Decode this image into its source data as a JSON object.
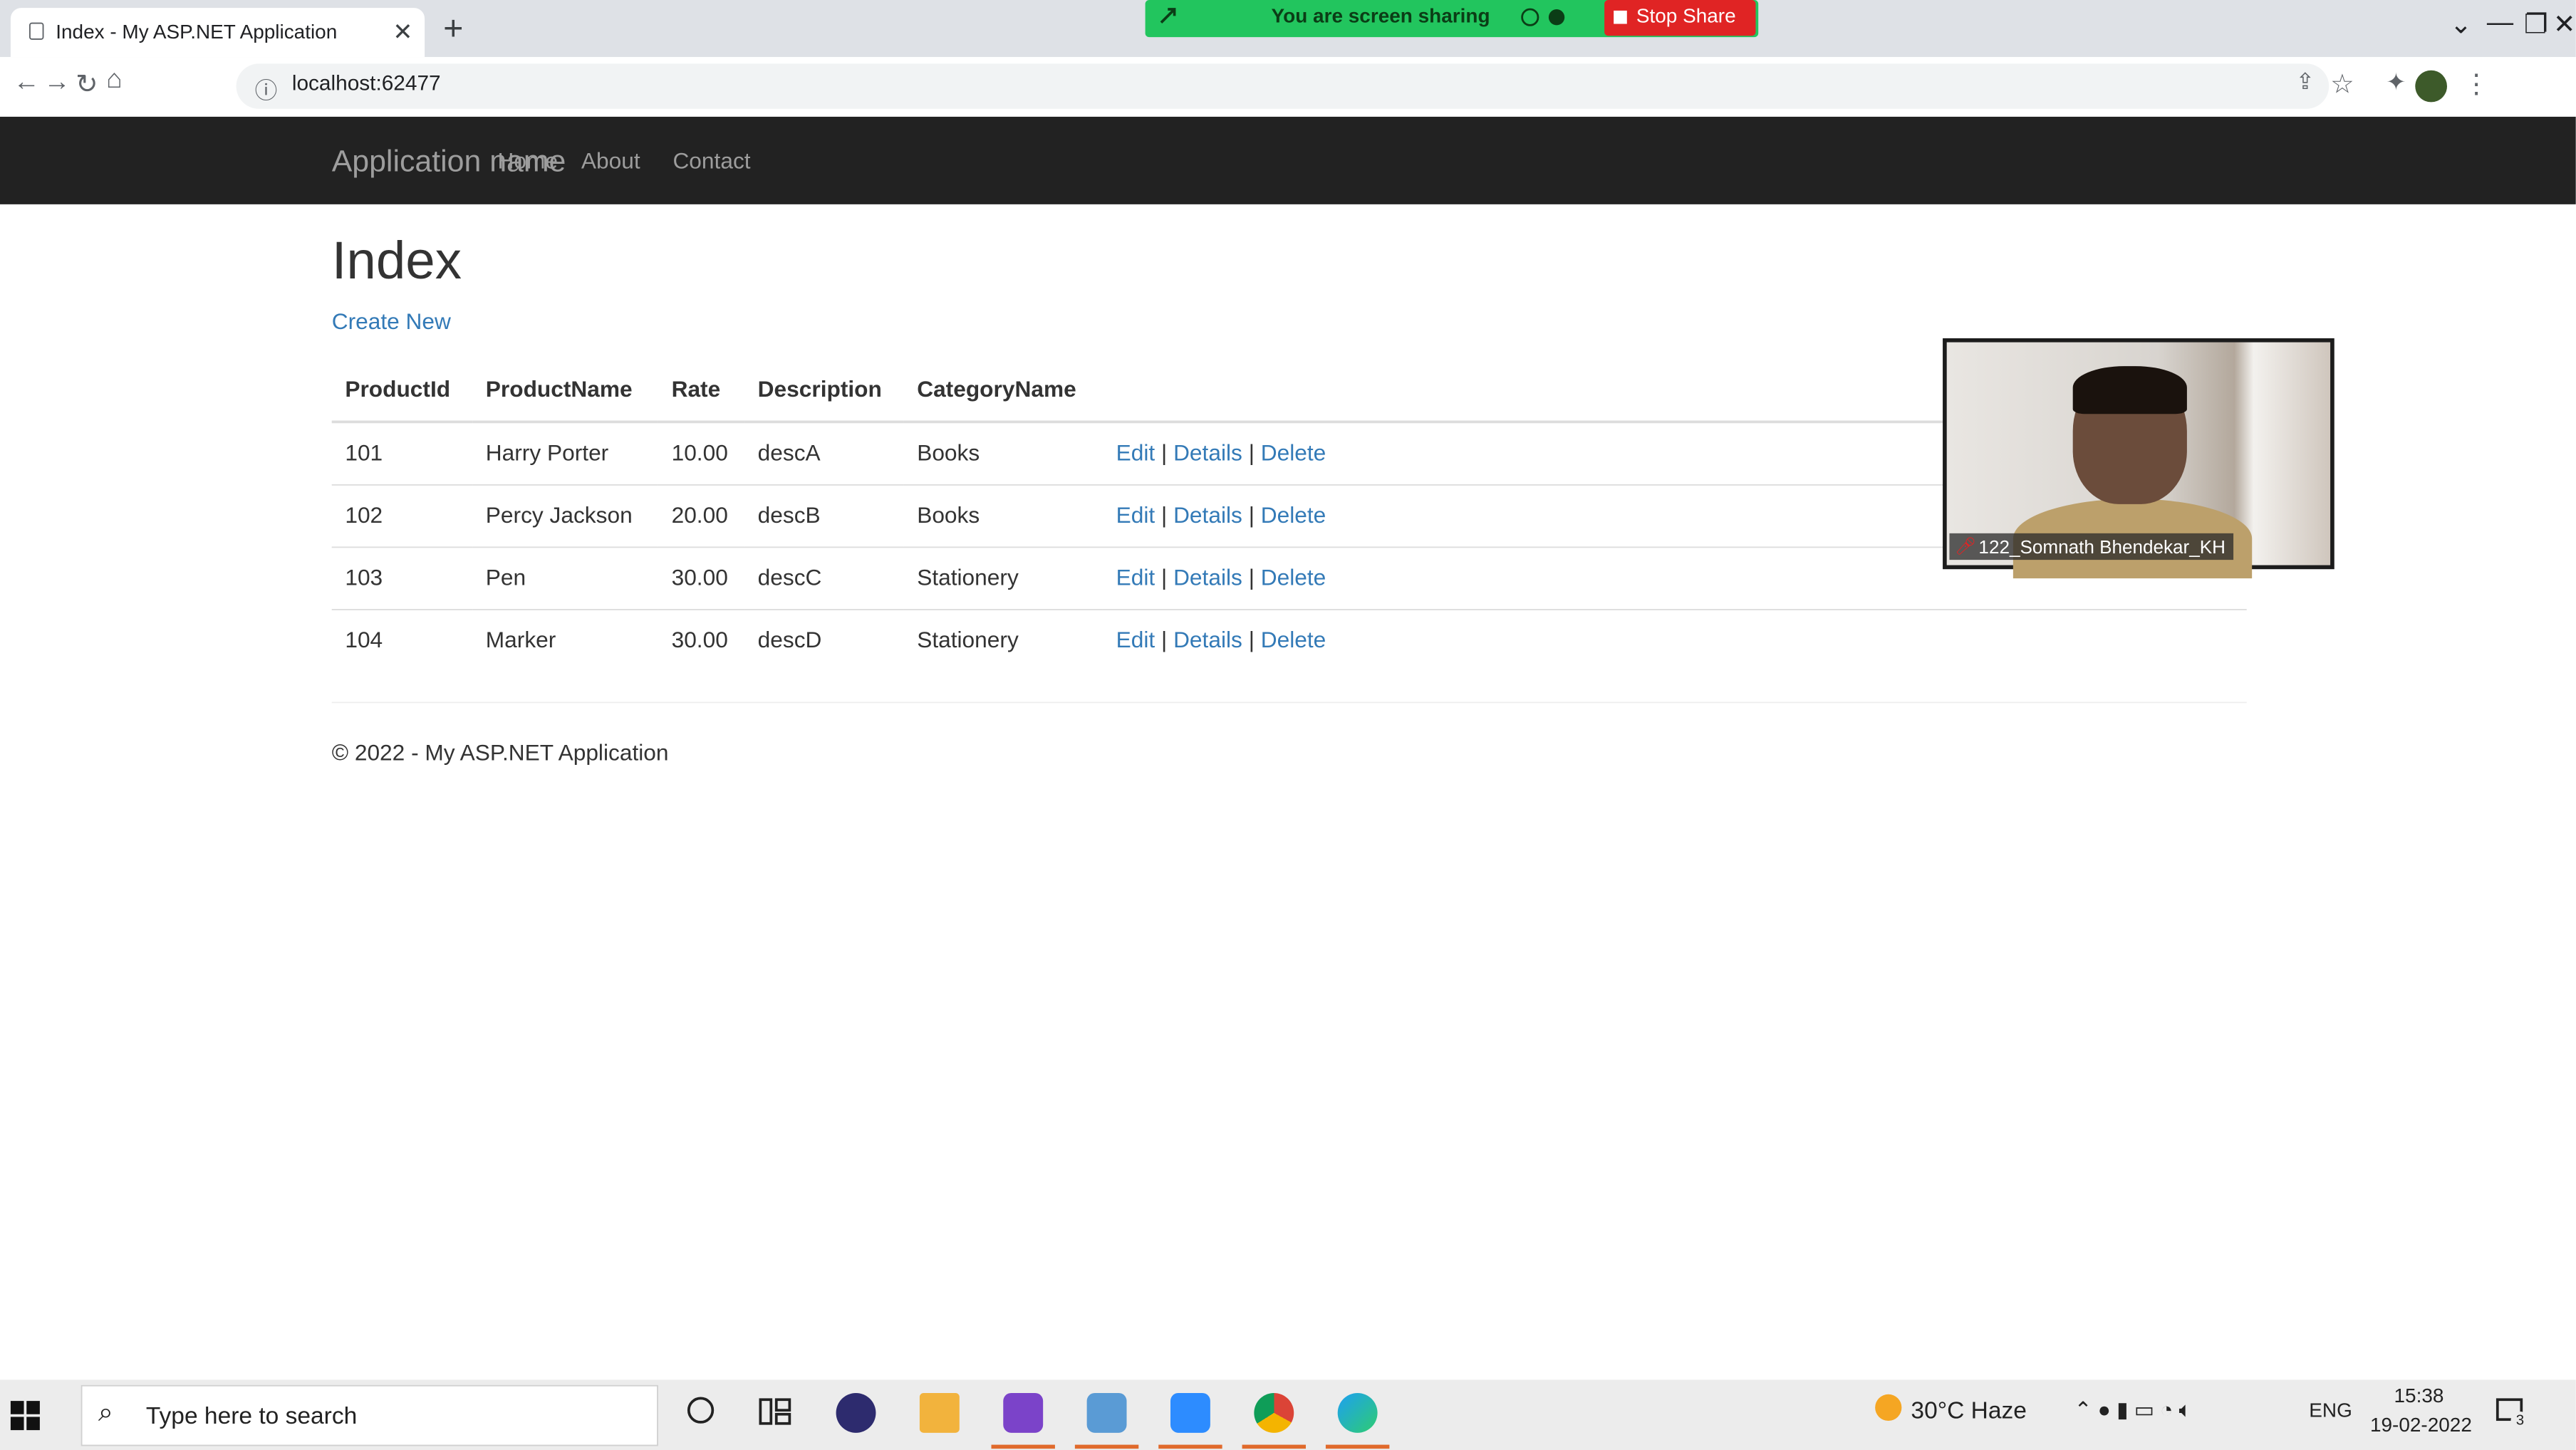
{
  "browser": {
    "tab_title": "Index - My ASP.NET Application",
    "tab_close": "✕",
    "new_tab": "+",
    "url": "localhost:62477",
    "share_text": "You are screen sharing",
    "stop_share_label": "Stop Share",
    "window_buttons": [
      "⌄",
      "—",
      "❐",
      "✕"
    ]
  },
  "site": {
    "brand": "Application name",
    "nav": [
      "Home",
      "About",
      "Contact"
    ],
    "heading": "Index",
    "create_new": "Create New",
    "columns": [
      "ProductId",
      "ProductName",
      "Rate",
      "Description",
      "CategoryName"
    ],
    "rows": [
      {
        "id": "101",
        "name": "Harry Porter",
        "rate": "10.00",
        "desc": "descA",
        "category": "Books"
      },
      {
        "id": "102",
        "name": "Percy Jackson",
        "rate": "20.00",
        "desc": "descB",
        "category": "Books"
      },
      {
        "id": "103",
        "name": "Pen",
        "rate": "30.00",
        "desc": "descC",
        "category": "Stationery"
      },
      {
        "id": "104",
        "name": "Marker",
        "rate": "30.00",
        "desc": "descD",
        "category": "Stationery"
      }
    ],
    "actions": {
      "edit": "Edit",
      "details": "Details",
      "delete": "Delete",
      "separator": "|"
    },
    "footer": "© 2022 - My ASP.NET Application"
  },
  "video": {
    "participant": "122_Somnath Bhendekar_KH"
  },
  "taskbar": {
    "search_placeholder": "Type here to search",
    "weather": "30°C  Haze",
    "language": "ENG",
    "time": "15:38",
    "date": "19-02-2022",
    "notification_count": "3"
  },
  "colors": {
    "navbar": "#222222",
    "link": "#337ab7",
    "share_bar": "#22c55e",
    "stop_share": "#e02424"
  }
}
